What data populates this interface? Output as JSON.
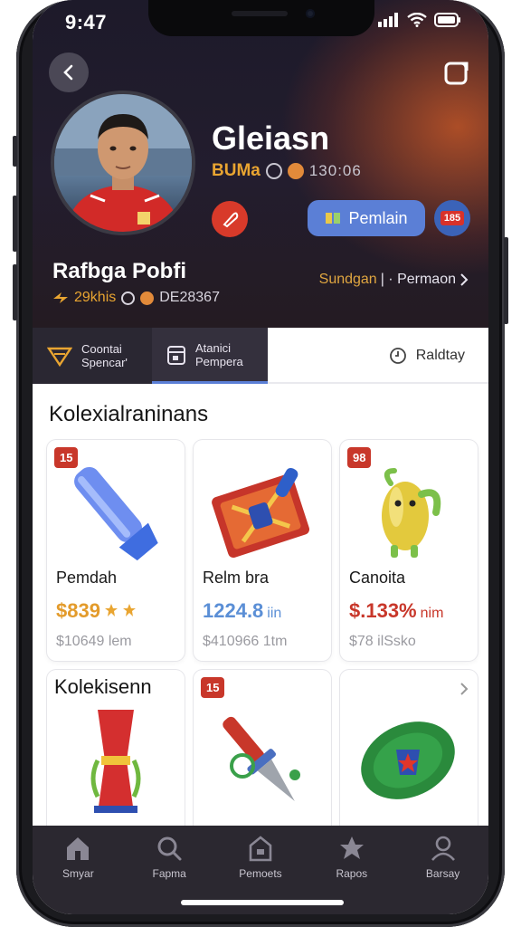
{
  "status_bar": {
    "time": "9:47"
  },
  "header": {
    "name": "Gleiasn",
    "tag": "BUMa",
    "meta_number": "130:06",
    "primary_button": "Pemlain",
    "badge": "185"
  },
  "profile": {
    "title": "Rafbga Pobfi",
    "stats_label": "29khis",
    "stats_number": "DE28367",
    "link_part1": "Sundgan",
    "link_part2": "| · Permaon"
  },
  "tabs": [
    {
      "line1": "Coontai",
      "line2": "Spencar'"
    },
    {
      "line1": "Atanici",
      "line2": "Pempera"
    },
    {
      "label": "Raldtay"
    }
  ],
  "section_title": "Kolexialraninans",
  "cards": [
    {
      "badge": "15",
      "name": "Pemdah",
      "price": "$839",
      "price_color": "#e39b2b",
      "sub": "$10649 lem"
    },
    {
      "name": "Relm bra",
      "price": "1224.8",
      "price_suffix": "iin",
      "price_color": "#5b8fd6",
      "sub": "$410966 1tm"
    },
    {
      "badge": "98",
      "name": "Canoita",
      "price": "$.133%",
      "price_suffix": "nim",
      "price_color": "#c8372a",
      "sub": "$78 ilSsko"
    }
  ],
  "section2_title": "Kolekisenn",
  "row2_badge": "15",
  "nav": [
    {
      "label": "Smyar",
      "icon": "home-icon"
    },
    {
      "label": "Fapma",
      "icon": "search-icon"
    },
    {
      "label": "Pemoets",
      "icon": "house-box-icon"
    },
    {
      "label": "Rapos",
      "icon": "star-icon"
    },
    {
      "label": "Barsay",
      "icon": "profile-icon"
    }
  ],
  "colors": {
    "accent": "#5b7fd6",
    "gold": "#e9a531",
    "red": "#d83a2a",
    "dark": "#2b2830"
  }
}
